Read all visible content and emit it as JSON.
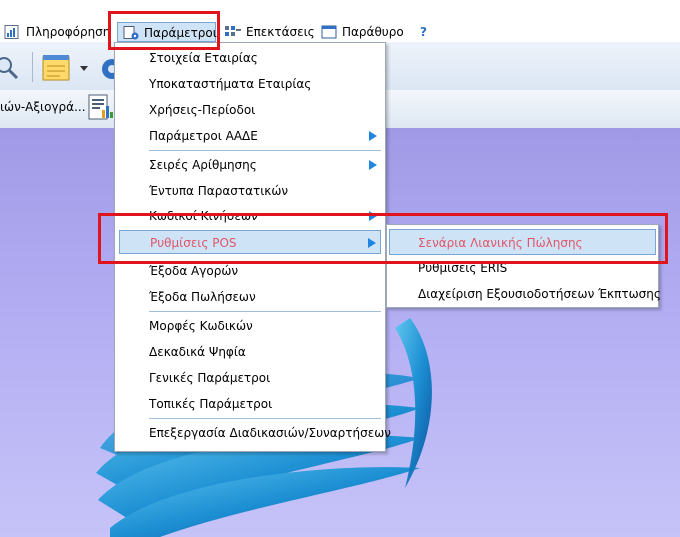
{
  "menubar": {
    "items": [
      {
        "label": "Πληροφόρηση"
      },
      {
        "label": "Παράμετροι"
      },
      {
        "label": "Επεκτάσεις"
      },
      {
        "label": "Παράθυρο"
      },
      {
        "label": "?"
      }
    ]
  },
  "toolbar2": {
    "label": "ιών-Αξιογρά..."
  },
  "menu": {
    "items": [
      {
        "label": "Στοιχεία Εταιρίας"
      },
      {
        "label": "Υποκαταστήματα Εταιρίας"
      },
      {
        "label": "Χρήσεις-Περίοδοι"
      },
      {
        "label": "Παράμετροι ΑΑΔΕ"
      },
      {
        "label": "Σειρές Αρίθμησης"
      },
      {
        "label": "Έντυπα Παραστατικών"
      },
      {
        "label": "Κωδικοί Κινήσεων"
      },
      {
        "label": "Ρυθμίσεις POS"
      },
      {
        "label": "Έξοδα Αγορών"
      },
      {
        "label": "Έξοδα Πωλήσεων"
      },
      {
        "label": "Μορφές Κωδικών"
      },
      {
        "label": "Δεκαδικά Ψηφία"
      },
      {
        "label": "Γενικές Παράμετροι"
      },
      {
        "label": "Τοπικές Παράμετροι"
      },
      {
        "label": "Επεξεργασία Διαδικασιών/Συναρτήσεων"
      }
    ]
  },
  "submenu": {
    "items": [
      {
        "label": "Σενάρια Λιανικής Πώλησης"
      },
      {
        "label": "Ρυθμίσεις ERIS"
      },
      {
        "label": "Διαχείριση Εξουσιοδοτήσεων Έκπτωσης"
      }
    ]
  },
  "colors": {
    "highlight_text": "#e0556a",
    "highlight_bg": "#cfe3f6",
    "annotation_red": "#e0141c",
    "submenu_arrow": "#1f86e0"
  }
}
